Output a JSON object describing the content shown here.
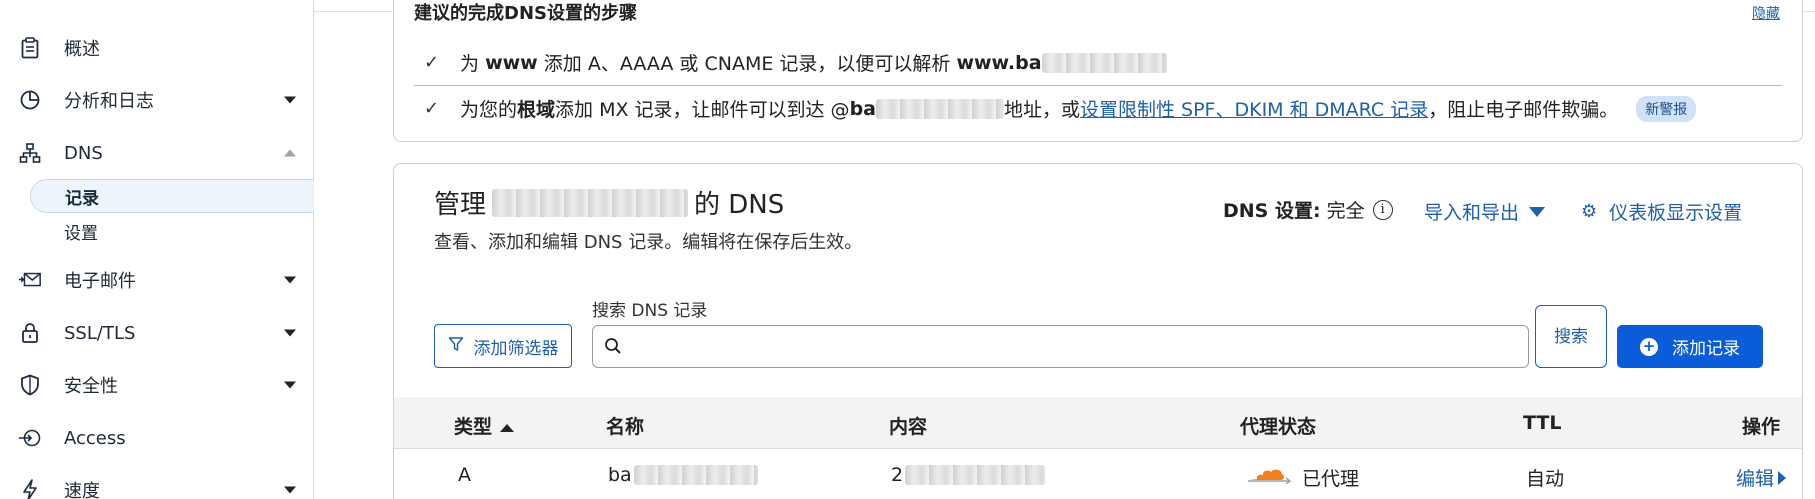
{
  "sidebar": {
    "items": [
      {
        "label": "概述",
        "icon": "clipboard-icon"
      },
      {
        "label": "分析和日志",
        "icon": "pie-chart-icon"
      },
      {
        "label": "DNS",
        "icon": "network-tree-icon"
      },
      {
        "label": "电子邮件",
        "icon": "email-forward-icon"
      },
      {
        "label": "SSL/TLS",
        "icon": "lock-icon"
      },
      {
        "label": "安全性",
        "icon": "shield-icon"
      },
      {
        "label": "Access",
        "icon": "access-icon"
      },
      {
        "label": "速度",
        "icon": "lightning-icon"
      }
    ],
    "dns_sub": [
      {
        "label": "记录"
      },
      {
        "label": "设置"
      }
    ]
  },
  "banner": {
    "title": "建议的完成DNS设置的步骤",
    "link": "隐藏",
    "row1": {
      "a": "为",
      "b": "www",
      "c": "添加 A、AAAA 或 CNAME 记录，以便可以解析",
      "d": "www.ba"
    },
    "row2": {
      "a": "为您的",
      "b": "根域",
      "c": "添加 MX 记录，让邮件可以到达 @",
      "d": "ba",
      "e": "地址，或",
      "link": "设置限制性 SPF、DKIM 和 DMARC 记录",
      "f": "，阻止电子邮件欺骗。",
      "badge": "新警报"
    }
  },
  "dns_card": {
    "title_prefix": "管理",
    "title_suffix": "的 DNS",
    "subtitle": "查看、添加和编辑 DNS 记录。编辑将在保存后生效。",
    "settings_key": "DNS 设置:",
    "settings_value": "完全",
    "import_export": "导入和导出",
    "dashboard_settings": "仪表板显示设置",
    "filter_button": "添加筛选器",
    "search_label": "搜索 DNS 记录",
    "search_placeholder": "",
    "search_button": "搜索",
    "add_button": "添加记录",
    "columns": [
      "类型",
      "名称",
      "内容",
      "代理状态",
      "TTL",
      "操作"
    ],
    "rows": [
      {
        "type": "A",
        "name": "ba",
        "content": "2",
        "proxy": "已代理",
        "ttl": "自动",
        "action": "编辑"
      }
    ]
  },
  "colors": {
    "accent": "#1e5fae",
    "primary_button": "#0b5cd8",
    "cloud_orange": "#f38020"
  }
}
